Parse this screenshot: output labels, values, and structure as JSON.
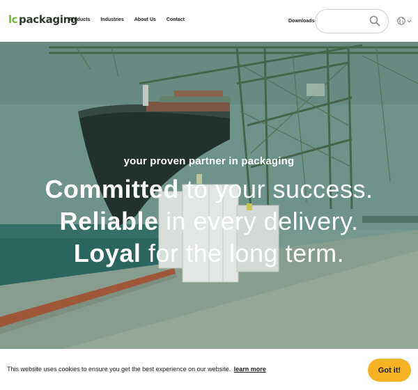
{
  "header": {
    "logo": {
      "lc": "lc",
      "packaging": "packaging",
      "tagline": "",
      "icon": "lc-packaging-logo"
    },
    "nav": [
      {
        "label": "Products"
      },
      {
        "label": "Industries"
      },
      {
        "label": "About Us"
      },
      {
        "label": "Contact"
      }
    ],
    "downloads_label": "Downloads",
    "search": {
      "placeholder": "",
      "value": "",
      "icon": "search-icon"
    },
    "language": {
      "icon": "globe-icon",
      "dropdown_icon": "chevron-down-icon"
    }
  },
  "hero": {
    "subtitle": "your proven partner in packaging",
    "lines": [
      {
        "bold": "Committed",
        "rest": "to your success."
      },
      {
        "bold": "Reliable",
        "rest": "in every delivery."
      },
      {
        "bold": "Loyal",
        "rest": "for the long term."
      }
    ],
    "image": "container-ship-port-with-bulk-bags"
  },
  "cookie": {
    "text": "This website uses cookies to ensure you get the best experience on our website.",
    "link_label": "learn more",
    "button_label": "Got it!",
    "button_color": "#f5b324"
  },
  "colors": {
    "brand_green": "#78b62a",
    "accent_yellow": "#f5b324"
  }
}
